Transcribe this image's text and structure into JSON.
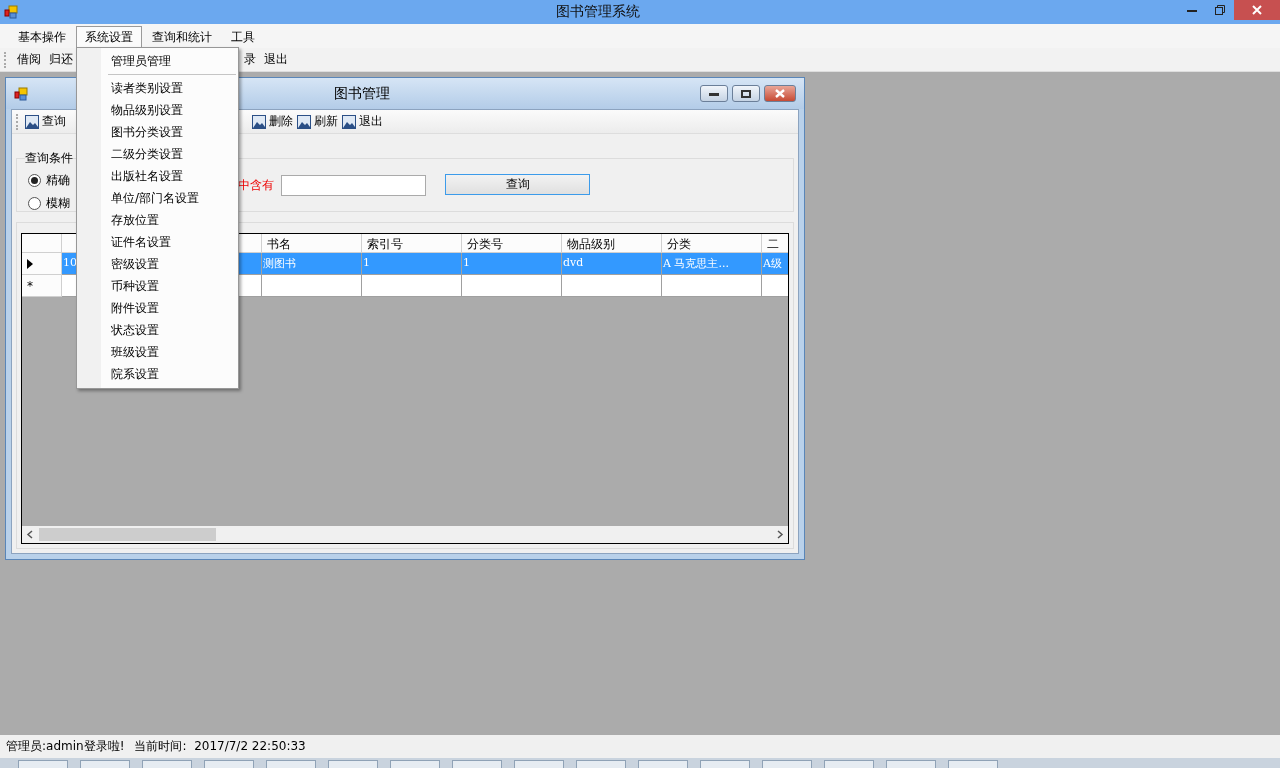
{
  "window": {
    "title": "图书管理系统"
  },
  "menu_bar": [
    {
      "label": "基本操作",
      "selected": false
    },
    {
      "label": "系统设置",
      "selected": true
    },
    {
      "label": "查询和统计",
      "selected": false
    },
    {
      "label": "工具",
      "selected": false
    }
  ],
  "dropdown": [
    {
      "label": "管理员管理",
      "separator_after": true
    },
    {
      "label": "读者类别设置",
      "separator_after": false
    },
    {
      "label": "物品级别设置",
      "separator_after": false
    },
    {
      "label": "图书分类设置",
      "separator_after": false
    },
    {
      "label": "二级分类设置",
      "separator_after": false
    },
    {
      "label": "出版社名设置",
      "separator_after": false
    },
    {
      "label": "单位/部门名设置",
      "separator_after": false
    },
    {
      "label": "存放位置",
      "separator_after": false
    },
    {
      "label": "证件名设置",
      "separator_after": false
    },
    {
      "label": "密级设置",
      "separator_after": false
    },
    {
      "label": "币种设置",
      "separator_after": false
    },
    {
      "label": "附件设置",
      "separator_after": false
    },
    {
      "label": "状态设置",
      "separator_after": false
    },
    {
      "label": "班级设置",
      "separator_after": false
    },
    {
      "label": "院系设置",
      "separator_after": false
    }
  ],
  "toolbar": [
    "借阅",
    "归还",
    "录",
    "退出"
  ],
  "child_window": {
    "title": "图书管理",
    "toolbar": [
      "查询",
      "删除",
      "刷新",
      "退出"
    ],
    "query": {
      "group_title": "查询条件",
      "options": [
        {
          "label": "精确",
          "selected": true
        },
        {
          "label": "模糊",
          "selected": false
        }
      ],
      "condition_label": "中含有",
      "search_button": "查询"
    },
    "table": {
      "columns": [
        "",
        "书名",
        "索引号",
        "分类号",
        "物品级别",
        "分类",
        "二"
      ],
      "rows": [
        {
          "kind": "data",
          "selected": true,
          "cells": [
            "10",
            "测图书",
            "1",
            "1",
            "dvd",
            "A  马克思主...",
            "A级"
          ]
        },
        {
          "kind": "new",
          "selected": false,
          "marker": "*",
          "cells": []
        }
      ]
    }
  },
  "status_bar": [
    "管理员:admin登录啦!",
    "当前时间:  2017/7/2 22:50:33"
  ]
}
